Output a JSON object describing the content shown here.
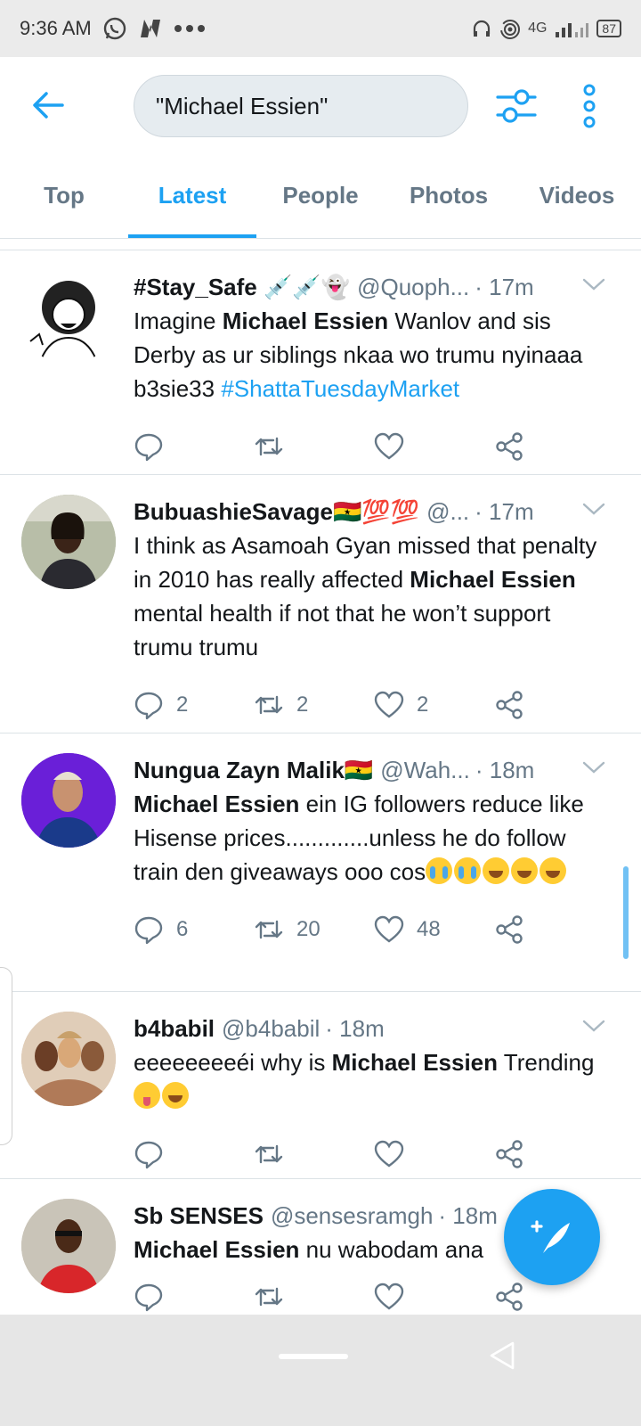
{
  "status_bar": {
    "time": "9:36 AM",
    "app_icons": [
      "whatsapp-icon",
      "n-app-icon",
      "more-dots-icon"
    ],
    "network": "4G",
    "battery": "87"
  },
  "header": {
    "search_value": "\"Michael Essien\""
  },
  "tabs": [
    {
      "label": "Top",
      "active": false
    },
    {
      "label": "Latest",
      "active": true
    },
    {
      "label": "People",
      "active": false
    },
    {
      "label": "Photos",
      "active": false
    },
    {
      "label": "Videos",
      "active": false
    }
  ],
  "tweets": [
    {
      "name": "#Stay_Safe 💉💉👻",
      "handle": "@Quoph...",
      "time": "· 17m",
      "text_parts": [
        {
          "t": "Imagine ",
          "style": "normal"
        },
        {
          "t": "Michael Essien",
          "style": "bold"
        },
        {
          "t": " Wanlov and sis Derby as ur siblings nkaa wo trumu nyinaaa b3sie33 ",
          "style": "normal"
        },
        {
          "t": "#ShattaTuesdayMarket",
          "style": "tag"
        }
      ],
      "replies": "",
      "retweets": "",
      "likes": ""
    },
    {
      "name": "BubuashieSavage🇬🇭💯💯",
      "handle": "@...",
      "time": "· 17m",
      "text_parts": [
        {
          "t": "I think as Asamoah Gyan missed that penalty in 2010 has really affected ",
          "style": "normal"
        },
        {
          "t": "Michael Essien",
          "style": "bold"
        },
        {
          "t": " mental health if not that he won’t support trumu trumu",
          "style": "normal"
        }
      ],
      "replies": "2",
      "retweets": "2",
      "likes": "2"
    },
    {
      "name": "Nungua Zayn Malik🇬🇭",
      "handle": "@Wah...",
      "time": "· 18m",
      "text_parts": [
        {
          "t": "Michael Essien",
          "style": "bold"
        },
        {
          "t": " ein IG followers reduce like Hisense prices.............unless he do follow train den giveaways ooo cos",
          "style": "normal"
        }
      ],
      "emojis": [
        "cry",
        "cry",
        "joy",
        "joy",
        "joy"
      ],
      "replies": "6",
      "retweets": "20",
      "likes": "48"
    },
    {
      "name": "b4babil",
      "handle": "@b4babil",
      "time": "· 18m",
      "text_parts": [
        {
          "t": "eeeeeeeeéi why is ",
          "style": "normal"
        },
        {
          "t": "Michael Essien",
          "style": "bold"
        },
        {
          "t": " Trending ",
          "style": "normal"
        }
      ],
      "emojis": [
        "zany",
        "joy"
      ],
      "replies": "",
      "retweets": "",
      "likes": ""
    },
    {
      "name": "Sb SENSES",
      "handle": "@sensesramgh",
      "time": "· 18m",
      "text_parts": [
        {
          "t": "Michael Essien",
          "style": "bold"
        },
        {
          "t": " nu wabodam ana",
          "style": "normal"
        }
      ],
      "replies": "",
      "retweets": "",
      "likes": ""
    }
  ],
  "colors": {
    "accent": "#1da1f2",
    "secondary_text": "#657786"
  }
}
